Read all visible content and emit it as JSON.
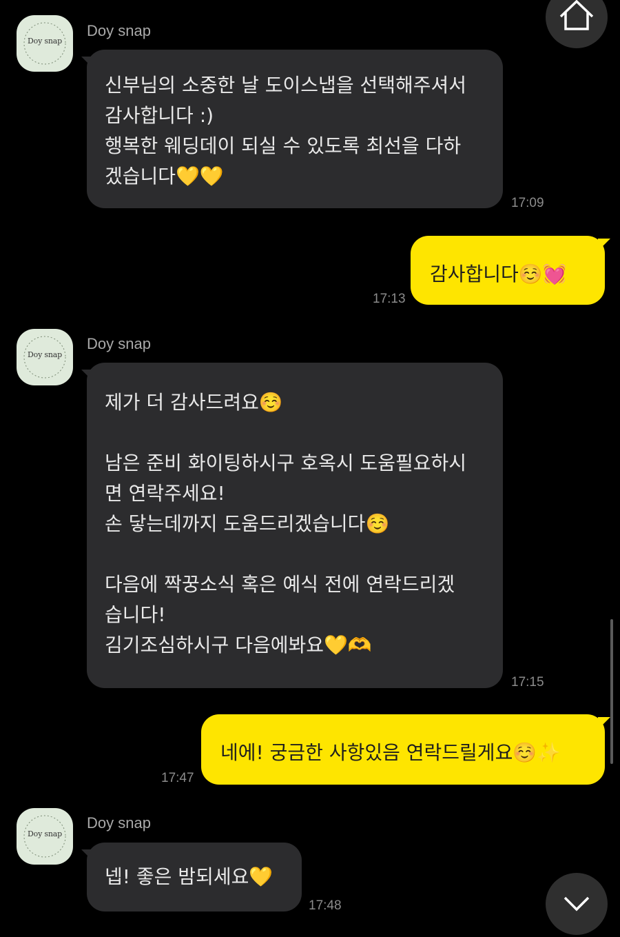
{
  "sender_name": "Doy snap",
  "avatar_logo_text": "Doy snap",
  "messages": [
    {
      "direction": "in",
      "text": "신부님의 소중한 날 도이스냅을 선택해주셔서\n감사합니다 :)\n행복한 웨딩데이 되실 수 있도록 최선을 다하\n겠습니다💛💛",
      "time": "17:09"
    },
    {
      "direction": "out",
      "text": "감사합니다☺️💓",
      "time": "17:13"
    },
    {
      "direction": "in",
      "text": "제가 더 감사드려요☺️\n\n남은 준비 화이팅하시구 호옥시 도움필요하시\n면 연락주세요!\n손 닿는데까지 도움드리겠습니다☺️\n\n다음에 짝꿍소식 혹은 예식 전에 연락드리겠\n습니다!\n김기조심하시구 다음에봐요💛🫶",
      "time": "17:15"
    },
    {
      "direction": "out",
      "text": "네에! 궁금한 사항있음 연락드릴게요☺️✨",
      "time": "17:47"
    },
    {
      "direction": "in",
      "text": "넵! 좋은 밤되세요💛",
      "time": "17:48"
    }
  ],
  "controls": {
    "home_icon": "home-icon",
    "scroll_down_icon": "chevron-down-icon"
  },
  "colors": {
    "background": "#000000",
    "incoming_bubble": "#2c2c2e",
    "outgoing_bubble": "#fee500",
    "avatar": "#dfeadb"
  }
}
